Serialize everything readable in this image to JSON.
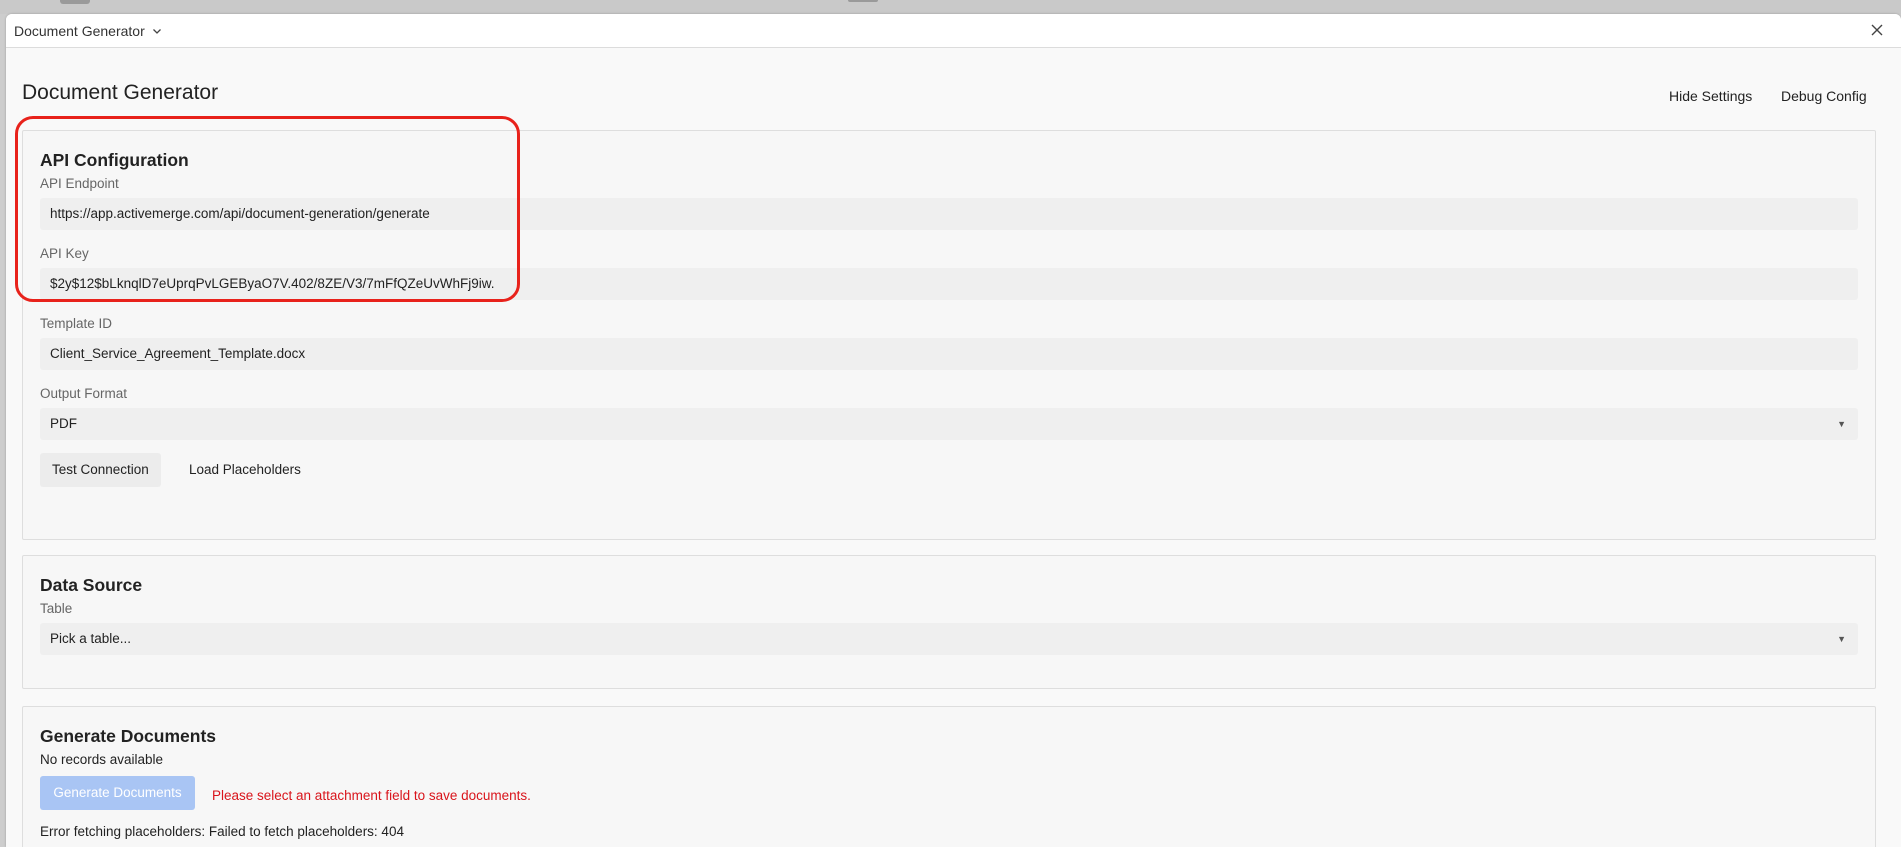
{
  "window": {
    "title": "Document Generator",
    "close_icon": "close-icon",
    "title_menu_icon": "chevron-down-icon"
  },
  "page": {
    "title": "Document Generator",
    "hide_settings_label": "Hide Settings",
    "debug_config_label": "Debug Config"
  },
  "api_config": {
    "heading": "API Configuration",
    "endpoint_label": "API Endpoint",
    "endpoint_value": "https://app.activemerge.com/api/document-generation/generate",
    "key_label": "API Key",
    "key_value": "$2y$12$bLknqlD7eUprqPvLGEByaO7V.402/8ZE/V3/7mFfQZeUvWhFj9iw.",
    "template_label": "Template ID",
    "template_value": "Client_Service_Agreement_Template.docx",
    "output_label": "Output Format",
    "output_value": "PDF",
    "test_connection_label": "Test Connection",
    "load_placeholders_label": "Load Placeholders"
  },
  "data_source": {
    "heading": "Data Source",
    "table_label": "Table",
    "table_placeholder": "Pick a table..."
  },
  "generate": {
    "heading": "Generate Documents",
    "status": "No records available",
    "button_label": "Generate Documents",
    "warning": "Please select an attachment field to save documents.",
    "error": "Error fetching placeholders: Failed to fetch placeholders: 404"
  },
  "colors": {
    "highlight": "#e8221b",
    "warning_text": "#d9141b",
    "disabled_button": "#a9c5f4"
  }
}
